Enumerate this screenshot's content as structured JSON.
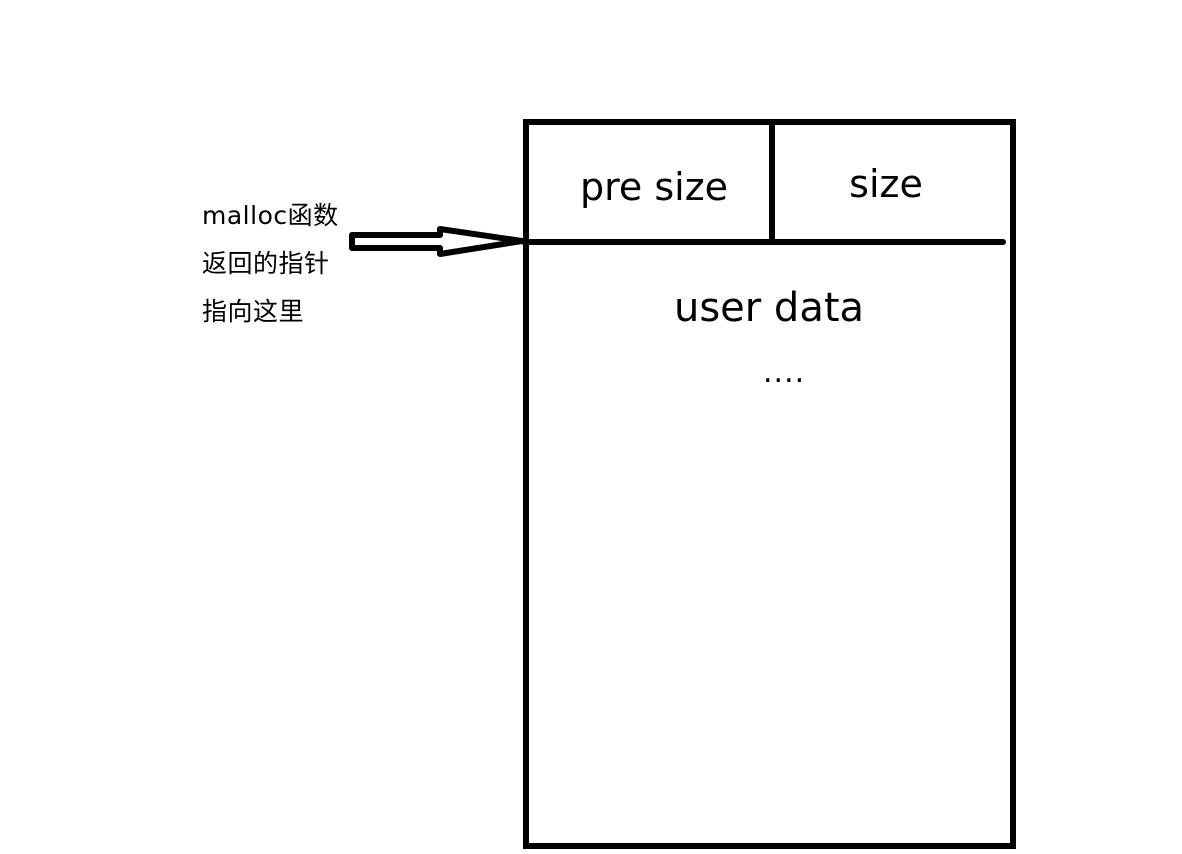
{
  "annotation": {
    "lines": [
      "malloc函数",
      "返回的指针",
      "指向这里"
    ]
  },
  "chunk": {
    "header_left": "pre size",
    "header_right": "size",
    "body_title": "user data",
    "body_more": "...."
  },
  "colors": {
    "stroke": "#000000",
    "background": "#ffffff"
  }
}
